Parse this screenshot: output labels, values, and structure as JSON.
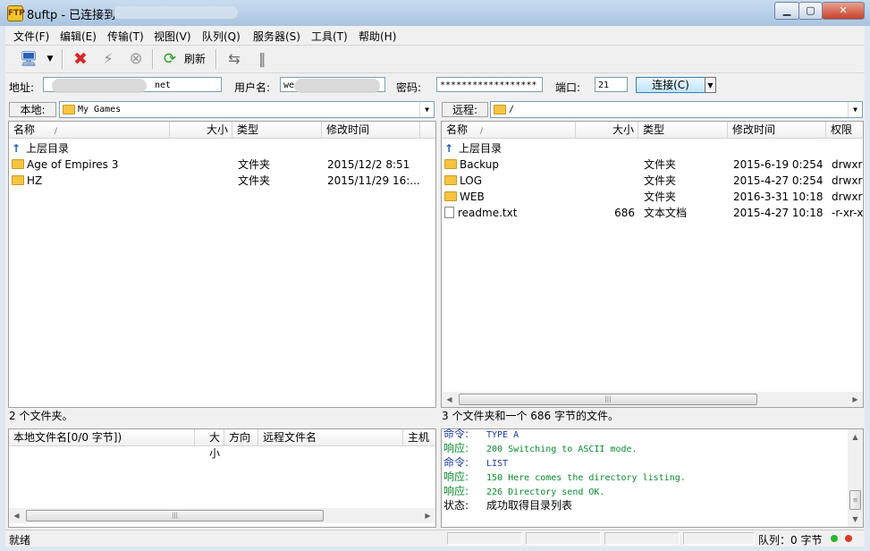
{
  "window": {
    "title": "8uftp - 已连接到",
    "app_icon": "FTP",
    "min": "▁",
    "max": "▢",
    "close": "✕"
  },
  "menu": [
    "文件(F)",
    "编辑(E)",
    "传输(T)",
    "视图(V)",
    "队列(Q)",
    "服务器(S)",
    "工具(T)",
    "帮助(H)"
  ],
  "toolbar": {
    "refresh_label": "刷新",
    "icons": {
      "connect": "🖥",
      "dropdown": "▼",
      "disconnect": "✖",
      "lightning": "⚡",
      "stop": "⊗",
      "refresh": "⟳",
      "transfer": "⇆",
      "pause": "‖"
    }
  },
  "connection": {
    "address_label": "地址:",
    "address_value": "net",
    "user_label": "用户名:",
    "user_value": "we",
    "password_label": "密码:",
    "password_value": "******************",
    "port_label": "端口:",
    "port_value": "21",
    "connect_label": "连接(C)"
  },
  "local": {
    "path_label": "本地:",
    "path": "My Games",
    "columns": [
      "名称",
      "大小",
      "类型",
      "修改时间"
    ],
    "sort_mark": "/",
    "up_label": "上层目录",
    "files": [
      {
        "name": "Age of Empires 3",
        "size": "",
        "type": "文件夹",
        "modified": "2015/12/2 8:51"
      },
      {
        "name": "HZ",
        "size": "",
        "type": "文件夹",
        "modified": "2015/11/29 16:..."
      }
    ],
    "status": "2 个文件夹。"
  },
  "remote": {
    "path_label": "远程:",
    "path": "/",
    "columns": [
      "名称",
      "大小",
      "类型",
      "修改时间",
      "权限"
    ],
    "sort_mark": "/",
    "up_label": "上层目录",
    "files": [
      {
        "name": "Backup",
        "size": "",
        "type": "文件夹",
        "modified": "2015-6-19 0:254",
        "perm": "drwxr",
        "kind": "folder"
      },
      {
        "name": "LOG",
        "size": "",
        "type": "文件夹",
        "modified": "2015-4-27 0:254",
        "perm": "drwxr",
        "kind": "folder"
      },
      {
        "name": "WEB",
        "size": "",
        "type": "文件夹",
        "modified": "2016-3-31 10:18",
        "perm": "drwxr",
        "kind": "folder"
      },
      {
        "name": "readme.txt",
        "size": "686",
        "type": "文本文档",
        "modified": "2015-4-27 10:18",
        "perm": "-r-xr-x",
        "kind": "file"
      }
    ],
    "status": "3 个文件夹和一个 686 字节的文件。"
  },
  "queue": {
    "columns": [
      "本地文件名[0/0 字节])",
      "大小",
      "方向",
      "远程文件名",
      "主机"
    ]
  },
  "log": [
    {
      "key": "命令:",
      "text": "TYPE A",
      "kind": "cmd"
    },
    {
      "key": "响应:",
      "text": "200 Switching to ASCII mode.",
      "kind": "resp"
    },
    {
      "key": "命令:",
      "text": "LIST",
      "kind": "cmd"
    },
    {
      "key": "响应:",
      "text": "150 Here comes the directory listing.",
      "kind": "resp"
    },
    {
      "key": "响应:",
      "text": "226 Directory send OK.",
      "kind": "resp"
    },
    {
      "key": "状态:",
      "text": "成功取得目录列表",
      "kind": "stat"
    }
  ],
  "statusbar": {
    "left": "就绪",
    "queue": "队列：0 字节"
  },
  "colors": {
    "accent": "#3c7fb1",
    "cmd": "#1a3ba8",
    "resp": "#0b8a2e",
    "dot_green": "#2db52d",
    "dot_red": "#d83a2a"
  }
}
